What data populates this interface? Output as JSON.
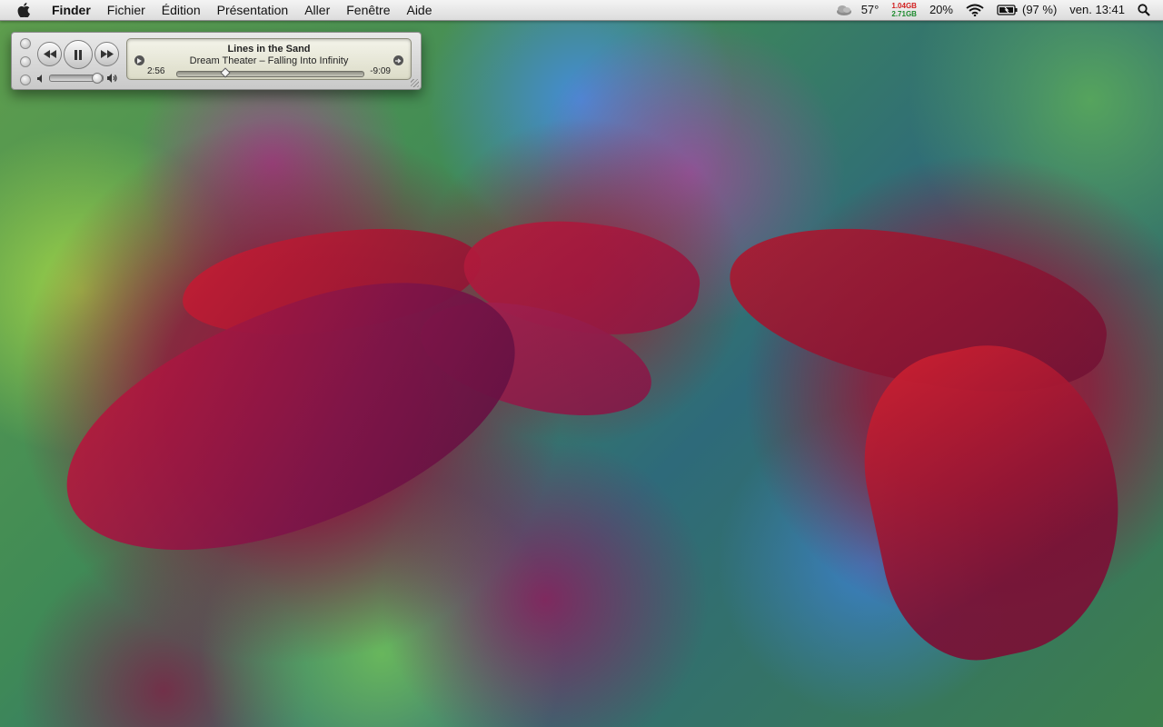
{
  "menubar": {
    "apple_icon": "apple-logo-icon",
    "app_name": "Finder",
    "items": [
      "Fichier",
      "Édition",
      "Présentation",
      "Aller",
      "Fenêtre",
      "Aide"
    ],
    "status": {
      "weather_icon": "weather-cloud-icon",
      "temperature": "57°",
      "memory_used": "1.04GB",
      "memory_free": "2.71GB",
      "cpu": "20%",
      "wifi_icon": "wifi-icon",
      "battery_icon": "battery-icon",
      "battery": "(97 %)",
      "clock": "ven. 13:41",
      "spotlight_icon": "spotlight-search-icon"
    }
  },
  "miniplayer": {
    "title": "Lines in the Sand",
    "subtitle": "Dream Theater – Falling Into Infinity",
    "elapsed": "2:56",
    "remaining": "-9:09",
    "progress": 0.245,
    "volume": 0.95,
    "colors": {
      "chrome": "#d7d7d7",
      "lcd": "#e9e9dc"
    }
  },
  "desktop": {
    "wallpaper": "blurred red leaves on green and blue bokeh"
  }
}
